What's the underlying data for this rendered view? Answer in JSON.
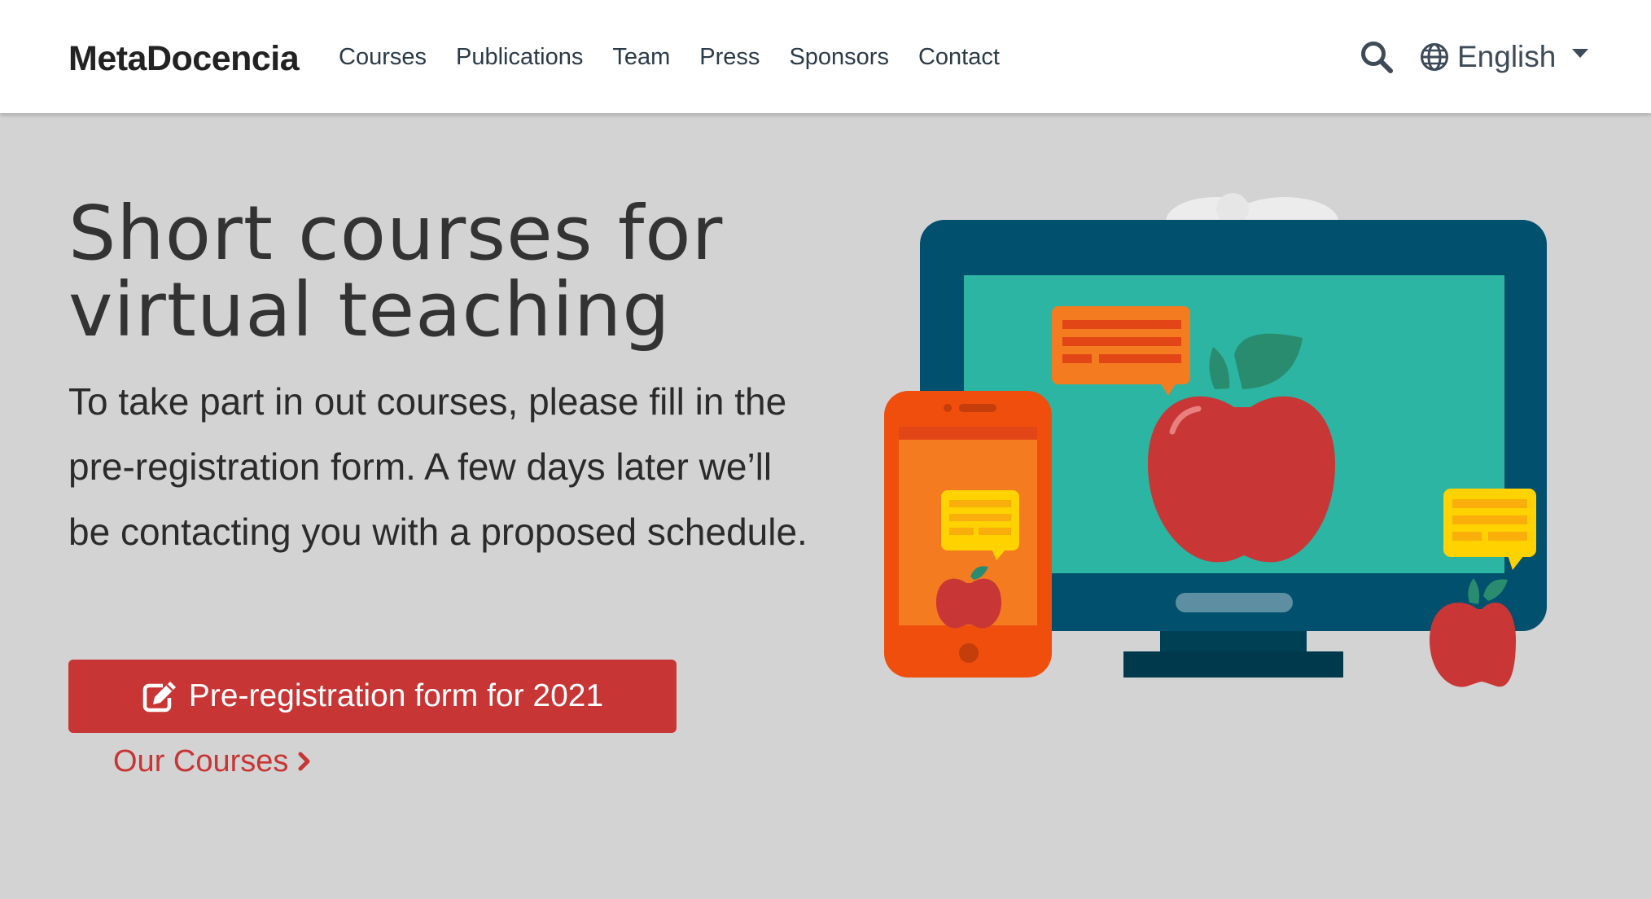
{
  "navbar": {
    "brand": "MetaDocencia",
    "links": [
      "Courses",
      "Publications",
      "Team",
      "Press",
      "Sponsors",
      "Contact"
    ],
    "search_icon": "search-icon",
    "language": {
      "icon": "globe-icon",
      "selected": "English"
    }
  },
  "hero": {
    "title": "Short courses for virtual teaching",
    "text": "To take part in out courses, please fill in the pre-registration form. A few days later we’ll be contacting you with a proposed schedule.",
    "cta": {
      "icon": "edit-icon",
      "label": "Pre-registration form for 2021"
    },
    "secondary_link": {
      "label": "Our Courses",
      "icon": "chevron-right-icon"
    }
  },
  "illustration": {
    "description_icon": "monitor-phone-apples-illustration"
  },
  "colors": {
    "accent": "#c73535",
    "background": "#d3d3d3",
    "navbar_bg": "#ffffff",
    "monitor_frame": "#00506e",
    "monitor_screen": "#2bb5a2",
    "phone_orange": "#f04e0c",
    "chat_orange": "#f47b20",
    "chat_yellow": "#ffd200",
    "apple_red": "#c83636",
    "leaf_green": "#2a8c6f"
  }
}
